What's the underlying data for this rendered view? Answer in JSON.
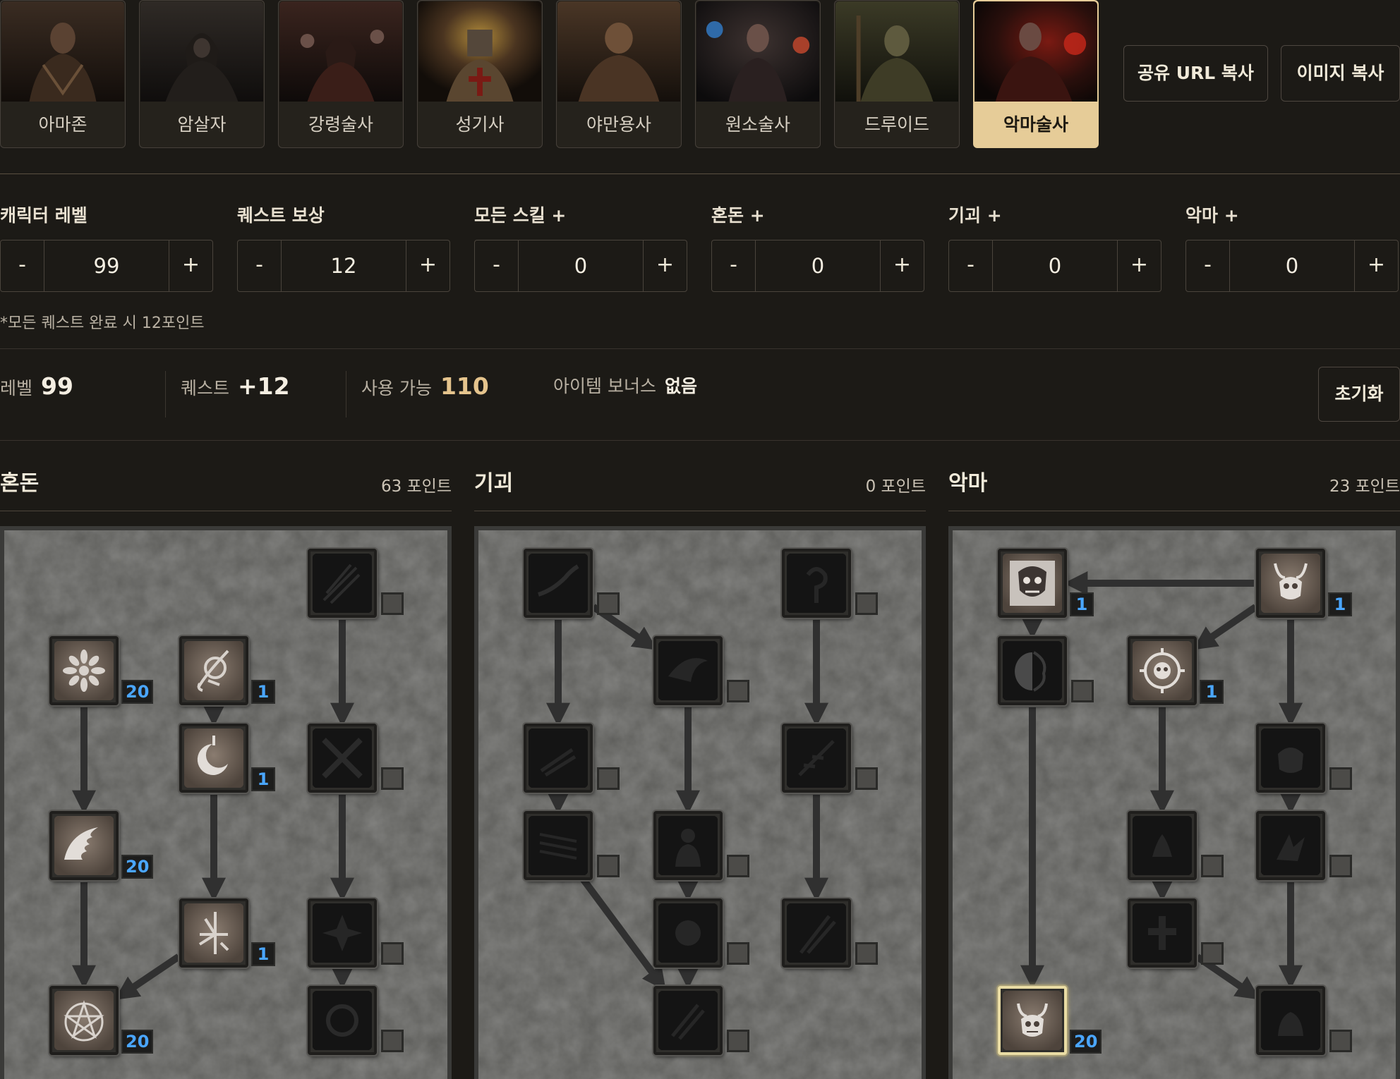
{
  "classes": [
    {
      "label": "아마존",
      "active": false
    },
    {
      "label": "암살자",
      "active": false
    },
    {
      "label": "강령술사",
      "active": false
    },
    {
      "label": "성기사",
      "active": false
    },
    {
      "label": "야만용사",
      "active": false
    },
    {
      "label": "원소술사",
      "active": false
    },
    {
      "label": "드루이드",
      "active": false
    },
    {
      "label": "악마술사",
      "active": true
    }
  ],
  "actions": {
    "share_url": "공유 URL 복사",
    "copy_image": "이미지 복사"
  },
  "steppers": [
    {
      "label": "캐릭터 레벨",
      "value": "99",
      "minus": "-",
      "plus": "+"
    },
    {
      "label": "퀘스트 보상",
      "value": "12",
      "minus": "-",
      "plus": "+"
    },
    {
      "label": "모든 스킬 +",
      "value": "0",
      "minus": "-",
      "plus": "+"
    },
    {
      "label": "혼돈 +",
      "value": "0",
      "minus": "-",
      "plus": "+"
    },
    {
      "label": "기괴 +",
      "value": "0",
      "minus": "-",
      "plus": "+"
    },
    {
      "label": "악마 +",
      "value": "0",
      "minus": "-",
      "plus": "+"
    }
  ],
  "quest_note": "*모든 퀘스트 완료 시 12포인트",
  "summary": {
    "level_label": "레벨",
    "level_value": "99",
    "quest_label": "퀘스트",
    "quest_value": "+12",
    "available_label": "사용 가능",
    "available_value": "110",
    "item_bonus_label": "아이템 보너스",
    "item_bonus_value": "없음",
    "reset_label": "초기화"
  },
  "colors": {
    "accent_gold": "#e6cc98",
    "points_gold": "#e5c48d",
    "level_blue": "#4aa6ff"
  },
  "trees": [
    {
      "name": "혼돈",
      "points": "63 포인트",
      "skills": [
        {
          "icon": "flower-burst-icon",
          "learned": true,
          "level": "20"
        },
        {
          "icon": "wave-claw-icon",
          "learned": true,
          "level": "20"
        },
        {
          "icon": "pentagram-icon",
          "learned": true,
          "level": "20"
        },
        {
          "icon": "struck-circle-sigil-icon",
          "learned": true,
          "level": "1"
        },
        {
          "icon": "crescent-moon-icon",
          "learned": true,
          "level": "1"
        },
        {
          "icon": "jagged-sigil-icon",
          "learned": true,
          "level": "1"
        },
        {
          "icon": "claw-slash-icon",
          "learned": false,
          "level": ""
        },
        {
          "icon": "crossed-chains-icon",
          "learned": false,
          "level": ""
        },
        {
          "icon": "shattered-star-icon",
          "learned": false,
          "level": ""
        },
        {
          "icon": "spiked-orb-icon",
          "learned": false,
          "level": ""
        }
      ]
    },
    {
      "name": "기괴",
      "points": "0 포인트",
      "skills": [
        {
          "icon": "grasping-hand-icon",
          "learned": false,
          "level": ""
        },
        {
          "icon": "shadow-slashes-icon",
          "learned": false,
          "level": ""
        },
        {
          "icon": "stacked-lines-icon",
          "learned": false,
          "level": ""
        },
        {
          "icon": "dark-wing-icon",
          "learned": false,
          "level": ""
        },
        {
          "icon": "shadow-figure-icon",
          "learned": false,
          "level": ""
        },
        {
          "icon": "dark-orb-icon",
          "learned": false,
          "level": ""
        },
        {
          "icon": "rending-claws-icon",
          "learned": false,
          "level": ""
        },
        {
          "icon": "hooked-sigil-icon",
          "learned": false,
          "level": ""
        },
        {
          "icon": "feathered-blades-icon",
          "learned": false,
          "level": ""
        },
        {
          "icon": "twin-daggers-icon",
          "learned": false,
          "level": ""
        }
      ]
    },
    {
      "name": "악마",
      "points": "23 포인트",
      "skills": [
        {
          "icon": "demon-mask-icon",
          "learned": true,
          "level": "1"
        },
        {
          "icon": "horned-skull-icon",
          "learned": true,
          "level": "1"
        },
        {
          "icon": "split-face-icon",
          "learned": false,
          "level": ""
        },
        {
          "icon": "spiked-skull-ring-icon",
          "learned": true,
          "level": "1"
        },
        {
          "icon": "grinning-skull-icon",
          "learned": false,
          "level": ""
        },
        {
          "icon": "flame-bowl-icon",
          "learned": false,
          "level": ""
        },
        {
          "icon": "burning-claw-icon",
          "learned": false,
          "level": ""
        },
        {
          "icon": "cross-skull-icon",
          "learned": false,
          "level": ""
        },
        {
          "icon": "horned-demon-face-icon",
          "learned": true,
          "level": "20"
        },
        {
          "icon": "shadow-beast-icon",
          "learned": false,
          "level": ""
        }
      ]
    }
  ]
}
